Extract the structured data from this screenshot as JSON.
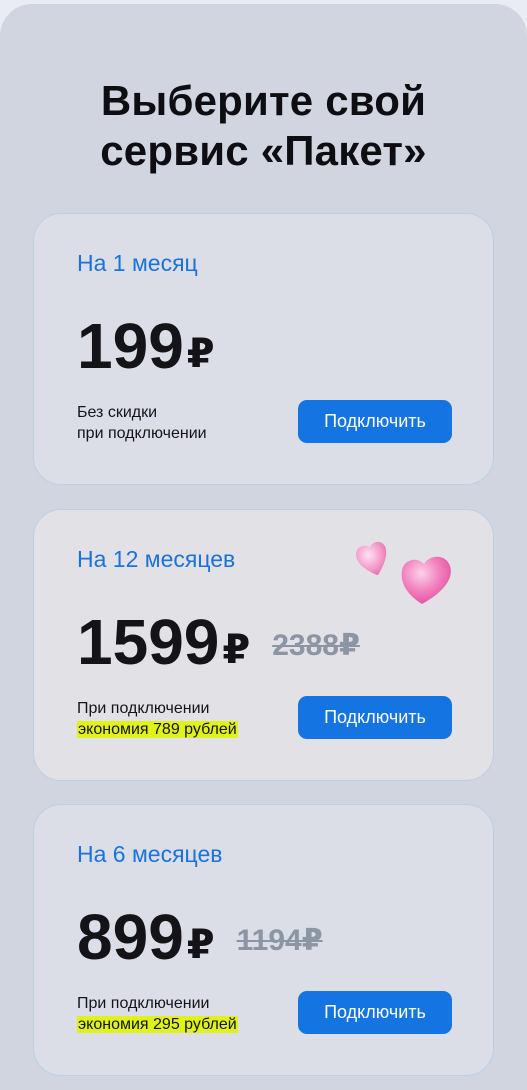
{
  "header": {
    "title_line1": "Выберите свой",
    "title_line2": "сервис «Пакет»"
  },
  "plans": [
    {
      "period": "На 1 месяц",
      "price": "199",
      "currency": "₽",
      "old_price": "",
      "note_line1": "Без скидки",
      "note_line2": "при подключении",
      "button": "Подключить"
    },
    {
      "period": "На 12 месяцев",
      "price": "1599",
      "currency": "₽",
      "old_price": "2388₽",
      "note_line1": "При подключении",
      "note_line2": "экономия 789 рублей",
      "button": "Подключить"
    },
    {
      "period": "На 6 месяцев",
      "price": "899",
      "currency": "₽",
      "old_price": "1194₽",
      "note_line1": "При подключении",
      "note_line2": "экономия 295 рублей",
      "button": "Подключить"
    }
  ],
  "colors": {
    "accent": "#1474e2",
    "period_text": "#1a73d8",
    "highlight": "#e0f21a",
    "heart": "#ee5fae"
  },
  "icons": {
    "decoration": "hearts-icon"
  }
}
